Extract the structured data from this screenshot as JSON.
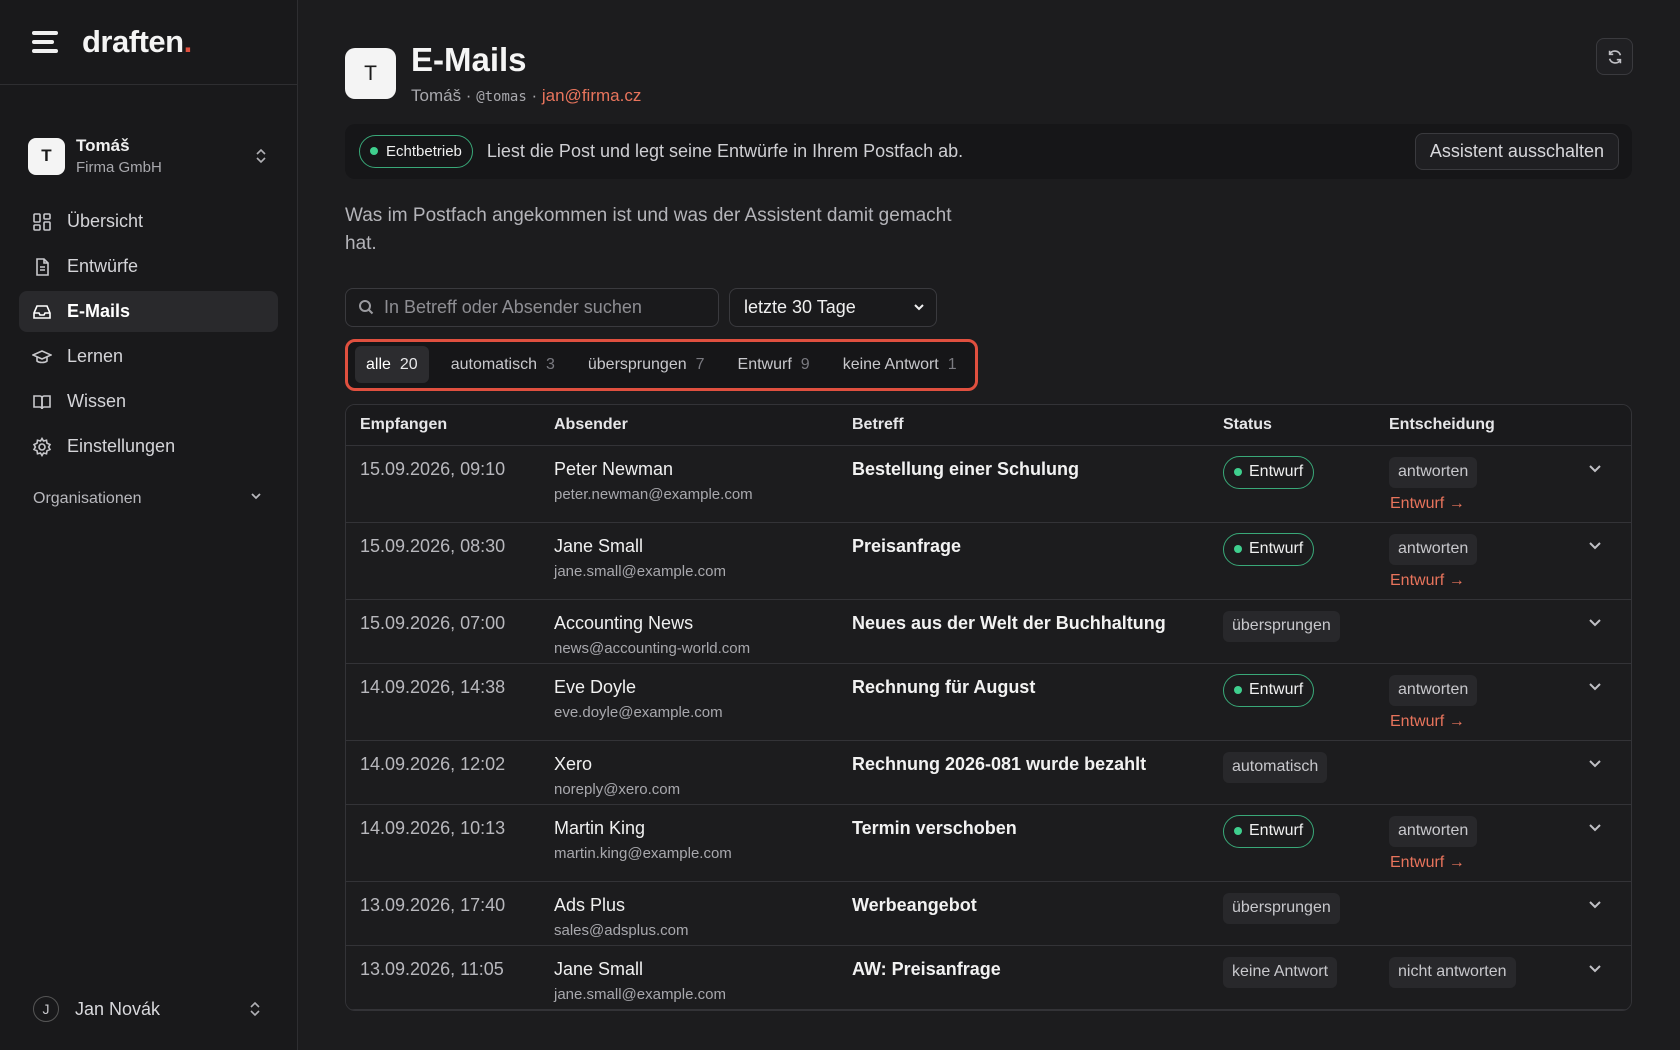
{
  "brand": {
    "logo_text": "draften",
    "logo_dot": ".",
    "accent": "#e0503f"
  },
  "org": {
    "avatar": "T",
    "name": "Tomáš",
    "company": "Firma GmbH"
  },
  "nav": [
    {
      "label": "Übersicht",
      "icon": "dashboard-icon"
    },
    {
      "label": "Entwürfe",
      "icon": "document-icon"
    },
    {
      "label": "E-Mails",
      "icon": "inbox-icon",
      "active": true
    },
    {
      "label": "Lernen",
      "icon": "graduation-cap-icon"
    },
    {
      "label": "Wissen",
      "icon": "book-icon"
    },
    {
      "label": "Einstellungen",
      "icon": "gear-icon"
    }
  ],
  "org_section": {
    "label": "Organisationen"
  },
  "user": {
    "avatar": "J",
    "name": "Jan Novák"
  },
  "header": {
    "avatar": "T",
    "title": "E-Mails",
    "name": "Tomáš",
    "sep1": " · ",
    "handle": "@tomas",
    "sep2": " · ",
    "email": "jan@firma.cz"
  },
  "banner": {
    "mode": "Echtbetrieb",
    "text": "Liest die Post und legt seine Entwürfe in Ihrem Postfach ab.",
    "button": "Assistent ausschalten"
  },
  "description": "Was im Postfach angekommen ist und was der Assistent damit gemacht hat.",
  "search": {
    "placeholder": "In Betreff oder Absender suchen"
  },
  "range": {
    "selected": "letzte 30 Tage"
  },
  "tabs": [
    {
      "label": "alle",
      "count": "20",
      "active": true
    },
    {
      "label": "automatisch",
      "count": "3"
    },
    {
      "label": "übersprungen",
      "count": "7"
    },
    {
      "label": "Entwurf",
      "count": "9"
    },
    {
      "label": "keine Antwort",
      "count": "1"
    }
  ],
  "table": {
    "headers": {
      "date": "Empfangen",
      "sender": "Absender",
      "subject": "Betreff",
      "status": "Status",
      "decision": "Entscheidung"
    },
    "rows": [
      {
        "date": "15.09.2026, 09:10",
        "sender": "Peter Newman",
        "email": "peter.newman@example.com",
        "subject": "Bestellung einer Schulung",
        "status": "Entwurf",
        "status_type": "draft",
        "decision": "antworten",
        "link": "Entwurf →"
      },
      {
        "date": "15.09.2026, 08:30",
        "sender": "Jane Small",
        "email": "jane.small@example.com",
        "subject": "Preisanfrage",
        "status": "Entwurf",
        "status_type": "draft",
        "decision": "antworten",
        "link": "Entwurf →"
      },
      {
        "date": "15.09.2026, 07:00",
        "sender": "Accounting News",
        "email": "news@accounting-world.com",
        "subject": "Neues aus der Welt der Buchhaltung",
        "status": "übersprungen",
        "status_type": "grey",
        "decision": "",
        "link": ""
      },
      {
        "date": "14.09.2026, 14:38",
        "sender": "Eve Doyle",
        "email": "eve.doyle@example.com",
        "subject": "Rechnung für August",
        "status": "Entwurf",
        "status_type": "draft",
        "decision": "antworten",
        "link": "Entwurf →"
      },
      {
        "date": "14.09.2026, 12:02",
        "sender": "Xero",
        "email": "noreply@xero.com",
        "subject": "Rechnung 2026-081 wurde bezahlt",
        "status": "automatisch",
        "status_type": "grey",
        "decision": "",
        "link": ""
      },
      {
        "date": "14.09.2026, 10:13",
        "sender": "Martin King",
        "email": "martin.king@example.com",
        "subject": "Termin verschoben",
        "status": "Entwurf",
        "status_type": "draft",
        "decision": "antworten",
        "link": "Entwurf →"
      },
      {
        "date": "13.09.2026, 17:40",
        "sender": "Ads Plus",
        "email": "sales@adsplus.com",
        "subject": "Werbeangebot",
        "status": "übersprungen",
        "status_type": "grey",
        "decision": "",
        "link": ""
      },
      {
        "date": "13.09.2026, 11:05",
        "sender": "Jane Small",
        "email": "jane.small@example.com",
        "subject": "AW: Preisanfrage",
        "status": "keine Antwort",
        "status_type": "grey",
        "decision": "nicht antworten",
        "link": ""
      }
    ]
  }
}
